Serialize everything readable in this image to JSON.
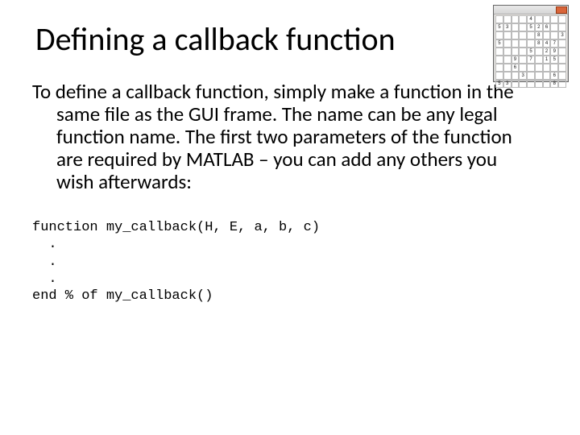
{
  "title": "Defining a callback function",
  "paragraph": "To define a callback function, simply make a function in the same file as the GUI frame.  The name can be any legal function name.  The first two parameters of the function are required by MATLAB – you can add any others you wish afterwards:",
  "code": {
    "l1": "function my_callback(H, E, a, b, c)",
    "l2": "  .",
    "l3": "  .",
    "l4": "  .",
    "l5": "end % of my_callback()"
  },
  "thumb": {
    "cells": [
      "",
      "",
      "",
      "",
      "4",
      "",
      "",
      "",
      "",
      "5",
      "3",
      "",
      "",
      "5",
      "2",
      "6",
      "",
      "",
      "",
      "",
      "",
      "",
      "",
      "8",
      "",
      "",
      "3",
      "5",
      "",
      "",
      "",
      "",
      "8",
      "4",
      "7",
      "",
      "",
      "",
      "",
      "",
      "5",
      "",
      "2",
      "9",
      "",
      "",
      "",
      "9",
      "",
      "7",
      "",
      "1",
      "5",
      "",
      "",
      "",
      "6",
      "",
      "",
      "",
      "",
      "",
      "",
      "",
      "",
      "",
      "3",
      "",
      "",
      "",
      "6",
      "",
      "5",
      "3",
      "",
      "",
      "",
      "",
      "",
      "8",
      ""
    ]
  }
}
